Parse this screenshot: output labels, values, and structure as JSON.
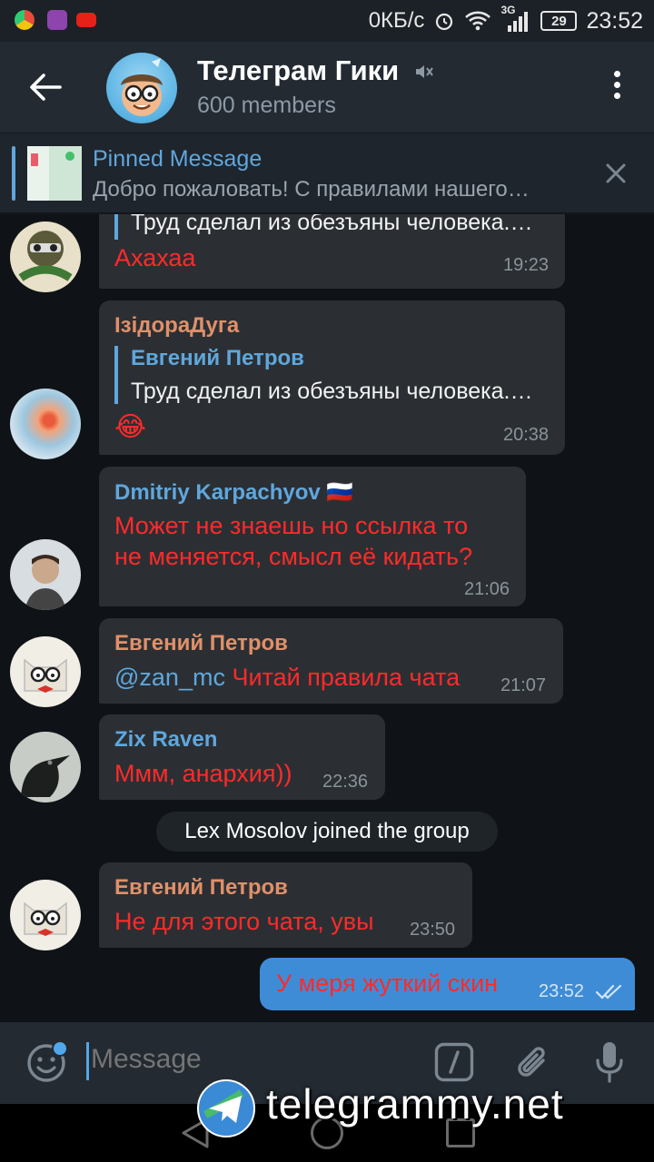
{
  "statusbar": {
    "speed": "0КБ/с",
    "network": "3G",
    "battery": "29",
    "time": "23:52"
  },
  "header": {
    "title": "Телеграм Гики",
    "subtitle": "600 members"
  },
  "pinned": {
    "title": "Pinned Message",
    "text": "Добро пожаловать! С правилами нашего…"
  },
  "messages": [
    {
      "reply_text": "Труд сделал из обезъяны человека.…",
      "text": "Ахахаа",
      "time": "19:23"
    },
    {
      "sender": "ІзідораДуга",
      "reply_name": "Евгений Петров",
      "reply_text": "Труд сделал из обезъяны человека.…",
      "text": "😂",
      "time": "20:38"
    },
    {
      "sender": "Dmitriy Karpachyov 🇷🇺",
      "text_line1": "Может не знаешь но ссылка то",
      "text_line2": "не меняется, смысл её кидать?",
      "time": "21:06"
    },
    {
      "sender": "Евгений Петров",
      "mention": "@zan_mc",
      "text": " Читай правила чата",
      "time": "21:07"
    },
    {
      "sender": "Zix Raven",
      "text": "Ммм, анархия))",
      "time": "22:36"
    },
    {
      "sender": "Евгений Петров",
      "text": "Не для этого чата, увы",
      "time": "23:50"
    }
  ],
  "service_message": "Lex Mosolov joined the group",
  "outgoing": {
    "text": "У меря жуткий скин",
    "time": "23:52"
  },
  "input": {
    "placeholder": "Message"
  },
  "watermark": "telegrammy.net",
  "colors": {
    "accent": "#5fa7dd",
    "red_text": "#ff2a2a",
    "out_bubble": "#3f8cd6",
    "name_orange": "#e0906a"
  }
}
